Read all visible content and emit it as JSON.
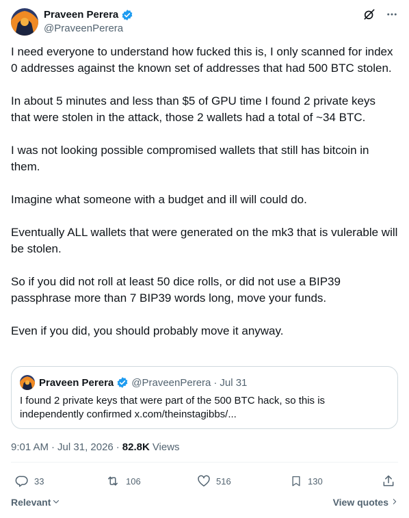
{
  "author": {
    "name": "Praveen Perera",
    "handle": "@PraveenPerera"
  },
  "tweet": {
    "paragraphs": [
      "I need everyone to understand how fucked this is, I only scanned for index 0 addresses against the known set of addresses that had 500 BTC stolen.",
      "In about 5 minutes and less than $5 of GPU time I found 2 private keys that were stolen in the attack, those 2 wallets had a total of ~34 BTC.",
      "I was not looking possible compromised wallets that still has bitcoin in them.",
      "Imagine what someone with a budget and ill will could do.",
      "Eventually ALL wallets that were generated on the mk3 that is vulerable will be stolen.",
      "So if you did not roll at least 50 dice rolls, or did not use a BIP39 passphrase more than 7 BIP39 words long, move your funds.",
      "Even if you did, you should probably move it anyway."
    ]
  },
  "quote": {
    "name": "Praveen Perera",
    "handle": "@PraveenPerera",
    "dot": "·",
    "date": "Jul 31",
    "text": "I found 2 private keys that were part of the 500 BTC hack, so this is independently confirmed ",
    "link": "x.com/theinstagibbs/..."
  },
  "meta": {
    "time": "9:01 AM",
    "dot1": "·",
    "date": "Jul 31, 2026",
    "dot2": "·",
    "views_count": "82.8K",
    "views_label": "Views"
  },
  "actions": {
    "replies": "33",
    "reposts": "106",
    "likes": "516",
    "bookmarks": "130"
  },
  "footer": {
    "sort_label": "Relevant",
    "view_quotes": "View quotes"
  },
  "icons": {
    "verified": "verified-badge-icon",
    "grok": "grok-icon",
    "more": "more-icon",
    "reply": "reply-icon",
    "repost": "repost-icon",
    "like": "heart-icon",
    "bookmark": "bookmark-icon",
    "share": "share-icon"
  },
  "colors": {
    "verified": "#1d9bf0",
    "text": "#0f1419",
    "secondary": "#536471",
    "border": "#cfd9de"
  }
}
